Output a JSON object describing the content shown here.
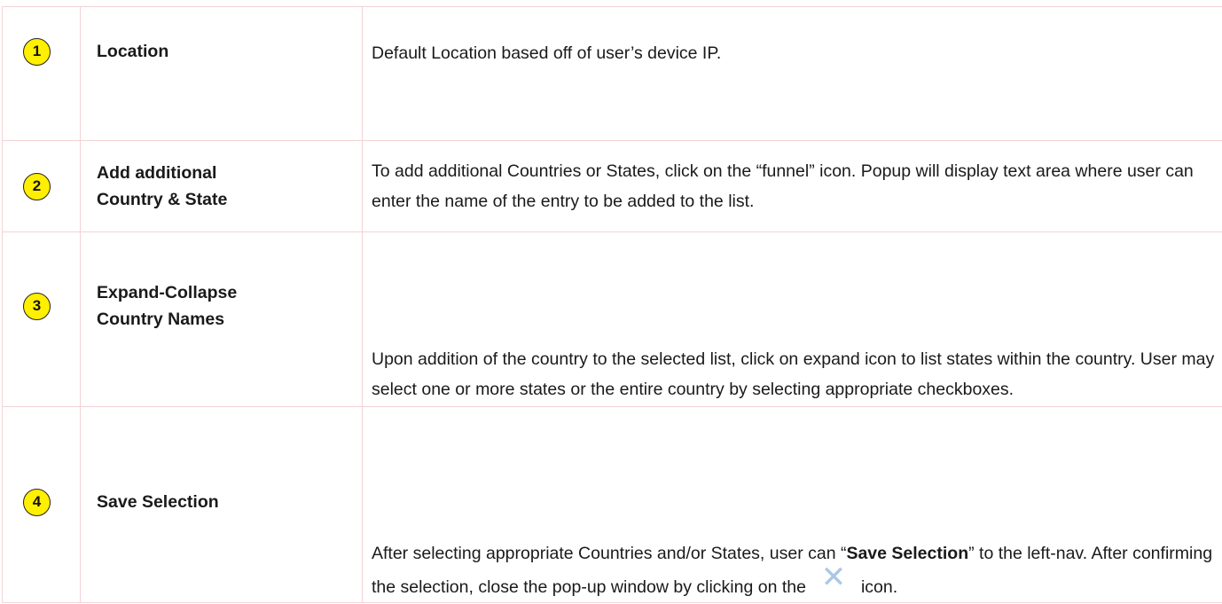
{
  "rows": [
    {
      "number": "1",
      "name": "Location",
      "description": "Default Location based off of user’s device IP."
    },
    {
      "number": "2",
      "name_line1": "Add additional",
      "name_line2": "Country & State",
      "description": "To add additional Countries or States, click on the “funnel” icon. Popup will display text area where user can enter the name of the entry to be added to the list."
    },
    {
      "number": "3",
      "name_line1": "Expand-Collapse",
      "name_line2": "Country Names",
      "description": "Upon addition of the country to the selected list, click on expand icon to list states within the country. User may select one or more states or the entire country by selecting appropriate checkboxes."
    },
    {
      "number": "4",
      "name": "Save Selection",
      "description_part1": "After selecting appropriate Countries and/or States, user can “",
      "description_bold": "Save Selection",
      "description_part2": "” to the left-nav. After confirming the selection, close the pop-up window by clicking on the",
      "description_part3": "icon.",
      "close_icon": "close-icon"
    }
  ],
  "colors": {
    "badge_fill": "#ffef00",
    "border": "#f2d3d6",
    "close_icon": "#a9c8e6"
  }
}
